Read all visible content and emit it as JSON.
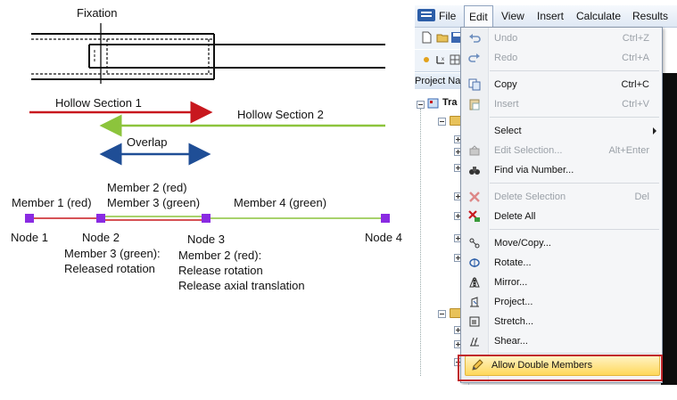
{
  "diagram": {
    "fixation_label": "Fixation",
    "hollow_section_1": "Hollow Section 1",
    "hollow_section_2": "Hollow Section 2",
    "overlap_label": "Overlap",
    "member1_label": "Member 1 (red)",
    "member2_label": "Member 2 (red)",
    "member3_label": "Member 3 (green)",
    "member4_label": "Member 4 (green)",
    "node1": "Node 1",
    "node2": "Node 2",
    "node3": "Node 3",
    "node4": "Node 4",
    "node2_note_line1": "Member 3 (green):",
    "node2_note_line2": "Released rotation",
    "node3_note_line1": "Member 2 (red):",
    "node3_note_line2": "Release rotation",
    "node3_note_line3": "Release axial translation",
    "colors": {
      "red": "#c8181e",
      "green": "#8cc43c",
      "blue": "#1f4e96",
      "node": "#8a2be2"
    }
  },
  "menubar": {
    "items": [
      "File",
      "Edit",
      "View",
      "Insert",
      "Calculate",
      "Results"
    ],
    "active": "Edit"
  },
  "navigator": {
    "header": "Project Navi",
    "root_label": "Tra"
  },
  "edit_menu": {
    "items": [
      {
        "label": "Undo",
        "shortcut": "Ctrl+Z",
        "disabled": true,
        "icon": "undo-icon"
      },
      {
        "label": "Redo",
        "shortcut": "Ctrl+A",
        "disabled": true,
        "icon": "redo-icon"
      },
      {
        "label": "Copy",
        "shortcut": "Ctrl+C",
        "disabled": false,
        "icon": "copy-icon"
      },
      {
        "label": "Insert",
        "shortcut": "Ctrl+V",
        "disabled": true,
        "icon": "paste-icon"
      },
      {
        "label": "Select",
        "shortcut": "",
        "disabled": false,
        "icon": "",
        "submenu": true
      },
      {
        "label": "Edit Selection...",
        "shortcut": "Alt+Enter",
        "disabled": true,
        "icon": "edit-selection-icon"
      },
      {
        "label": "Find via Number...",
        "shortcut": "",
        "disabled": false,
        "icon": "binoculars-icon"
      },
      {
        "label": "Delete Selection",
        "shortcut": "Del",
        "disabled": true,
        "icon": "delete-icon"
      },
      {
        "label": "Delete All",
        "shortcut": "",
        "disabled": false,
        "icon": "delete-all-icon"
      },
      {
        "label": "Move/Copy...",
        "shortcut": "",
        "disabled": false,
        "icon": "move-icon"
      },
      {
        "label": "Rotate...",
        "shortcut": "",
        "disabled": false,
        "icon": "rotate-icon"
      },
      {
        "label": "Mirror...",
        "shortcut": "",
        "disabled": false,
        "icon": "mirror-icon"
      },
      {
        "label": "Project...",
        "shortcut": "",
        "disabled": false,
        "icon": "project-icon"
      },
      {
        "label": "Stretch...",
        "shortcut": "",
        "disabled": false,
        "icon": "stretch-icon"
      },
      {
        "label": "Shear...",
        "shortcut": "",
        "disabled": false,
        "icon": "shear-icon"
      },
      {
        "label": "Allow Double Members",
        "shortcut": "",
        "disabled": false,
        "icon": "pencil-icon",
        "highlighted": true
      }
    ]
  }
}
